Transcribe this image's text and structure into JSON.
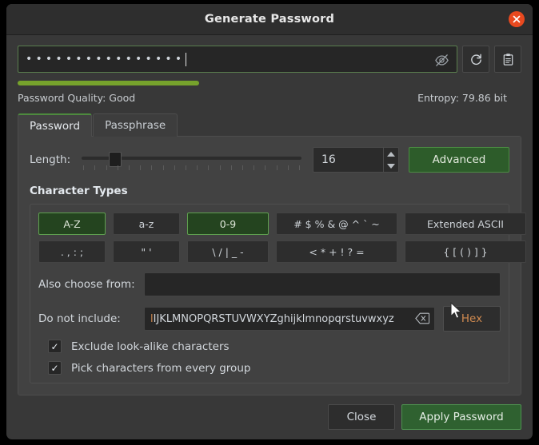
{
  "window": {
    "title": "Generate Password",
    "close_icon": "close-circle-icon"
  },
  "password": {
    "masked_value": "••••••••••••••••",
    "visibility_icon": "eye-off-icon",
    "regenerate_icon": "refresh-icon",
    "copy_icon": "clipboard-icon",
    "quality_label": "Password Quality: Good",
    "quality_percent": 36,
    "quality_color": "#76a22c",
    "entropy_label": "Entropy: 79.86 bit"
  },
  "tabs": [
    {
      "label": "Password",
      "active": true
    },
    {
      "label": "Passphrase",
      "active": false
    }
  ],
  "length": {
    "label": "Length:",
    "value": "16",
    "slider_percent": 12.5,
    "advanced_label": "Advanced"
  },
  "character_types": {
    "title": "Character Types",
    "buttons": [
      {
        "label": "A-Z",
        "selected": true
      },
      {
        "label": "a-z",
        "selected": false
      },
      {
        "label": "0-9",
        "selected": true
      },
      {
        "label": "# $ % & @ ^ ` ~",
        "selected": false
      },
      {
        "label": "Extended ASCII",
        "selected": false
      },
      {
        "label": ". , : ;",
        "selected": false
      },
      {
        "label": "\" '",
        "selected": false
      },
      {
        "label": "\\ / | _ -",
        "selected": false
      },
      {
        "label": "< * + ! ? =",
        "selected": false
      },
      {
        "label": "{ [ ( ) ] }",
        "selected": false
      }
    ]
  },
  "also_choose": {
    "label": "Also choose from:",
    "value": "",
    "placeholder": ""
  },
  "do_not_include": {
    "label": "Do not include:",
    "value_lead": "l",
    "value": "IJKLMNOPQRSTUVWXYZghijklmnopqrstuvwxyz",
    "clear_icon": "clear-field-icon",
    "hex_label": "Hex"
  },
  "options": [
    {
      "label": "Exclude look-alike characters",
      "checked": true,
      "mark": "✓"
    },
    {
      "label": "Pick characters from every group",
      "checked": true,
      "mark": "✓"
    }
  ],
  "footer": {
    "close_label": "Close",
    "apply_label": "Apply Password"
  }
}
